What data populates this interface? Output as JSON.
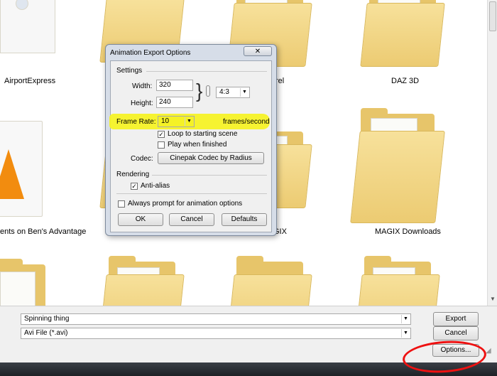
{
  "folders": [
    {
      "label": "AirportExpress"
    },
    {
      "label": "rel"
    },
    {
      "label": "DAZ 3D"
    },
    {
      "label": "ents on Ben's Advantage"
    },
    {
      "label": "GIX"
    },
    {
      "label": "MAGIX Downloads"
    }
  ],
  "dialog": {
    "title": "Animation Export Options",
    "close_icon": "close-icon",
    "settings_heading": "Settings",
    "width_label": "Width:",
    "width_value": "320",
    "height_label": "Height:",
    "height_value": "240",
    "aspect_value": "4:3",
    "framerate_label": "Frame Rate:",
    "framerate_value": "10",
    "framerate_units": "frames/second",
    "loop_label": "Loop to starting scene",
    "loop_checked": true,
    "play_label": "Play when finished",
    "play_checked": false,
    "codec_label": "Codec:",
    "codec_value": "Cinepak Codec by Radius",
    "rendering_heading": "Rendering",
    "antialias_label": "Anti-alias",
    "antialias_checked": true,
    "prompt_label": "Always prompt for animation options",
    "prompt_checked": false,
    "ok_label": "OK",
    "cancel_label": "Cancel",
    "defaults_label": "Defaults"
  },
  "export_panel": {
    "filename_value": "Spinning thing",
    "filetype_value": "Avi File (*.avi)",
    "export_label": "Export",
    "cancel_label": "Cancel",
    "options_label": "Options..."
  },
  "colors": {
    "highlight": "#f5f226",
    "annotation_circle": "#ee1111",
    "folder": "#e7c56a"
  }
}
